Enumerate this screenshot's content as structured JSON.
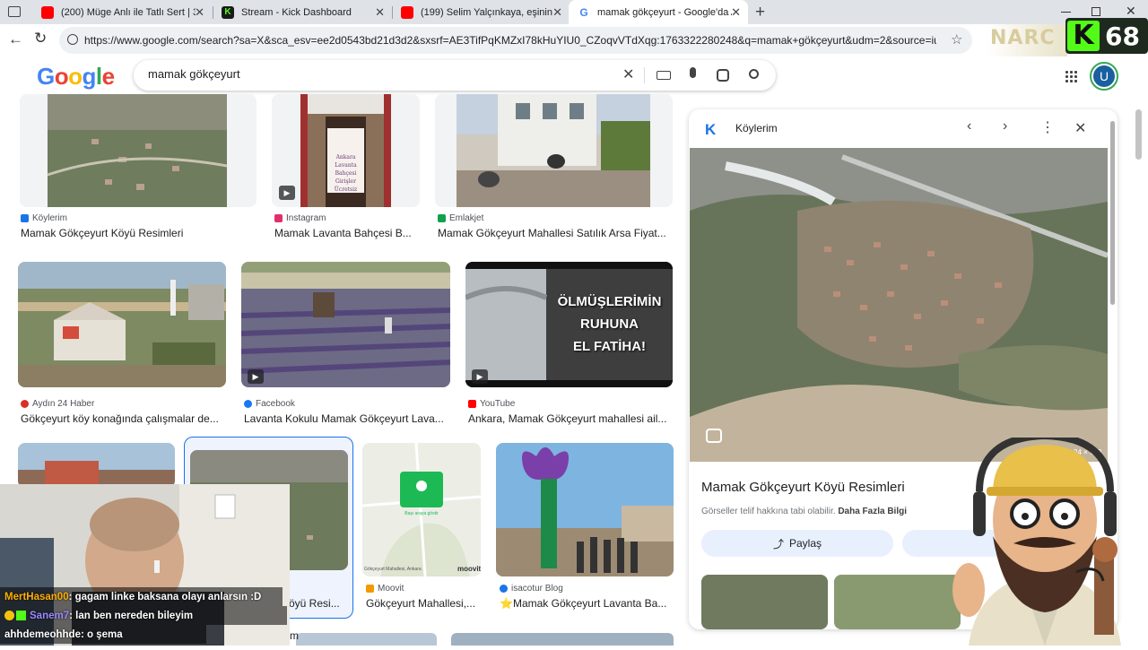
{
  "tabs": [
    {
      "title": "(200) Müge Anlı ile Tatlı Sert | 3 H",
      "favicon_color": "#ff0000"
    },
    {
      "title": "Stream - Kick Dashboard",
      "favicon_color": "#53fc18"
    },
    {
      "title": "(199) Selim Yalçınkaya, eşinin ihan",
      "favicon_color": "#ff0000"
    },
    {
      "title": "mamak gökçeyurt - Google'da Ar",
      "favicon_color": "#4285f4"
    }
  ],
  "address_bar": {
    "url": "https://www.google.com/search?sa=X&sca_esv=ee2d0543bd21d3d2&sxsrf=AE3TifPqKMZxI78kHuYIU0_CZoqvVTdXqg:1763322280248&q=mamak+gökçeyurt&udm=2&source=iu&ictx..."
  },
  "google": {
    "logo": "Google",
    "query": "mamak gökçeyurt",
    "avatar_letter": "U"
  },
  "results": [
    {
      "source": "Köylerim",
      "title": "Mamak Gökçeyurt Köyü Resimleri",
      "source_color": "#1a73e8"
    },
    {
      "source": "Instagram",
      "title": "Mamak Lavanta Bahçesi B...",
      "source_color": "#e1306c"
    },
    {
      "source": "Emlakjet",
      "title": "Mamak Gökçeyurt Mahallesi Satılık Arsa Fiyat...",
      "source_color": "#0fa14b"
    },
    {
      "source": "Aydın 24 Haber",
      "title": "Gökçeyurt köy konağında çalışmalar de...",
      "source_color": "#d93025"
    },
    {
      "source": "Facebook",
      "title": "Lavanta Kokulu Mamak Gökçeyurt Lava...",
      "source_color": "#1877f2"
    },
    {
      "source": "YouTube",
      "title": "Ankara, Mamak Gökçeyurt mahallesi ail...",
      "source_color": "#ff0000"
    },
    {
      "source": "",
      "title": "öyü Resi..."
    },
    {
      "source": "Moovit",
      "title": "Gökçeyurt Mahallesi,...",
      "source_color": "#f29900"
    },
    {
      "source": "isacotur Blog",
      "title": "⭐Mamak Gökçeyurt Lavanta Ba...",
      "source_color": "#1a73e8"
    },
    {
      "source": "",
      "title": "m"
    }
  ],
  "video_overlay_text": [
    "ÖLMÜŞLERİMİN",
    "RUHUNA",
    "EL FATİHA!"
  ],
  "sign_text": {
    "line1": "Ankara",
    "line2": "Lavanta Bahçesi",
    "line3": "Girişler Ücretsiz"
  },
  "map_labels": {
    "attribution": "Gökçeyurt Mahallesi, Ankara",
    "brand": "moovit",
    "btn": "Başı araya göstir"
  },
  "panel": {
    "source": "Köylerim",
    "title": "Mamak Gökçeyurt Köyü Resimleri",
    "rights_text": "Görseller telif hakkına tabi olabilir.",
    "more_info": "Daha Fazla Bilgi",
    "share_label": "Paylaş",
    "dims": "24 × 768"
  },
  "chat": [
    {
      "user": "MertHasan00",
      "msg": ": gagam linke baksana olayı anlarsın :D",
      "color": "#ffb000"
    },
    {
      "user": "Sanem7",
      "msg": ": lan ben nereden bileyim",
      "color": "#9a8cff"
    },
    {
      "user": "ahhdemeohhde",
      "msg": ": o şema",
      "color": "#ffffff"
    }
  ],
  "stream_badge": {
    "letter": "K",
    "count": "68"
  },
  "watermark": "NARC"
}
